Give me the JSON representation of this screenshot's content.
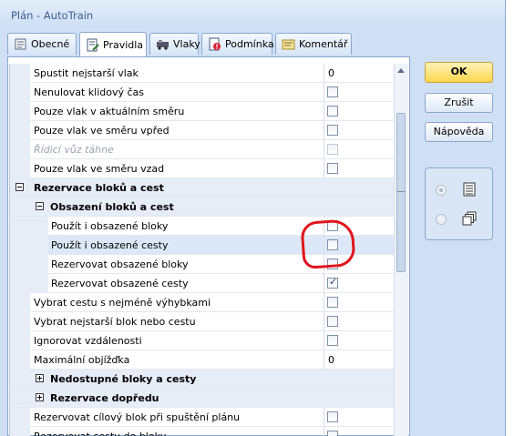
{
  "window": {
    "title": "Plán - AutoTrain"
  },
  "tabs": [
    {
      "label": "Obecné",
      "icon": "general-icon"
    },
    {
      "label": "Pravidla",
      "icon": "rules-icon",
      "active": true
    },
    {
      "label": "Vlaky",
      "icon": "trains-icon"
    },
    {
      "label": "Podmínka",
      "icon": "condition-icon"
    },
    {
      "label": "Komentář",
      "icon": "comment-icon"
    }
  ],
  "buttons": {
    "ok": "OK",
    "cancel": "Zrušit",
    "help": "Nápověda"
  },
  "rows": [
    {
      "label": "Spustit nejstarší vlak",
      "type": "text",
      "value": "0"
    },
    {
      "label": "Nenulovat klidový čas",
      "type": "check",
      "checked": false
    },
    {
      "label": "Pouze vlak v aktuálním směru",
      "type": "check",
      "checked": false
    },
    {
      "label": "Pouze vlak ve směru vpřed",
      "type": "check",
      "checked": false
    },
    {
      "label": "Řídicí vůz táhne",
      "type": "check",
      "checked": false,
      "disabled": true
    },
    {
      "label": "Pouze vlak ve směru vzad",
      "type": "check",
      "checked": false
    },
    {
      "label": "Rezervace bloků a cest",
      "type": "category",
      "expanded": true,
      "level": 0
    },
    {
      "label": "Obsazení bloků a cest",
      "type": "category",
      "expanded": true,
      "level": 1
    },
    {
      "label": "Použít i obsazené bloky",
      "type": "check",
      "checked": false,
      "level": 2
    },
    {
      "label": "Použít i obsazené cesty",
      "type": "check",
      "checked": false,
      "level": 2,
      "selected": true
    },
    {
      "label": "Rezervovat obsazené bloky",
      "type": "check",
      "checked": false,
      "level": 2
    },
    {
      "label": "Rezervovat obsazené cesty",
      "type": "check",
      "checked": true,
      "level": 2
    },
    {
      "label": "Vybrat cestu s nejméně výhybkami",
      "type": "check",
      "checked": false
    },
    {
      "label": "Vybrat nejstarší blok nebo cestu",
      "type": "check",
      "checked": false
    },
    {
      "label": "Ignorovat vzdálenosti",
      "type": "check",
      "checked": false
    },
    {
      "label": "Maximální objížďka",
      "type": "text",
      "value": "0"
    },
    {
      "label": "Nedostupné bloky a cesty",
      "type": "category",
      "expanded": false,
      "level": 1
    },
    {
      "label": "Rezervace dopředu",
      "type": "category",
      "expanded": false,
      "level": 1
    },
    {
      "label": "Rezervovat cílový blok při spuštění plánu",
      "type": "check",
      "checked": false
    },
    {
      "label": "Rezervovat cestu do bloku",
      "type": "check",
      "checked": false
    }
  ],
  "view_options": [
    {
      "icon": "list-view-icon",
      "selected": true
    },
    {
      "icon": "cascade-view-icon",
      "selected": false
    }
  ],
  "colors": {
    "accent_ok": "#fcd64f",
    "frame": "#cfe0f5",
    "annotation": "#e1141b"
  }
}
